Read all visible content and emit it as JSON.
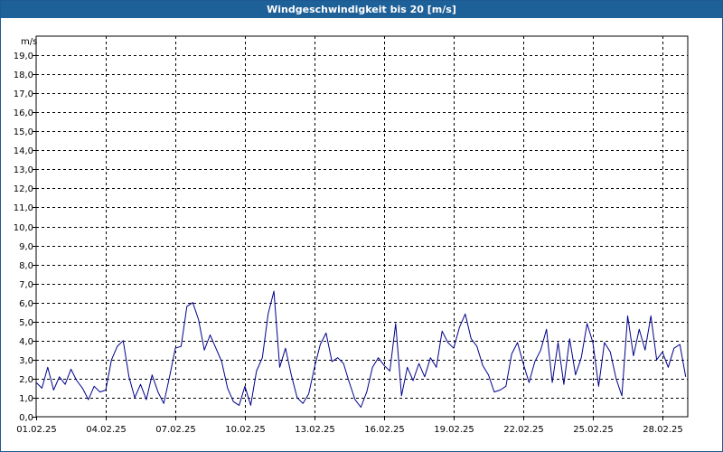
{
  "window": {
    "title": "Windgeschwindigkeit bis 20 [m/s]"
  },
  "chart_data": {
    "type": "line",
    "title": "Windgeschwindigkeit bis 20 [m/s]",
    "ylabel": "m/s",
    "xlabel": "",
    "ylim": [
      0,
      20
    ],
    "y_ticks": [
      0.0,
      1.0,
      2.0,
      3.0,
      4.0,
      5.0,
      6.0,
      7.0,
      8.0,
      9.0,
      10.0,
      11.0,
      12.0,
      13.0,
      14.0,
      15.0,
      16.0,
      17.0,
      18.0,
      19.0
    ],
    "y_tick_labels": [
      "0,0",
      "1,0",
      "2,0",
      "3,0",
      "4,0",
      "5,0",
      "6,0",
      "7,0",
      "8,0",
      "9,0",
      "10,0",
      "11,0",
      "12,0",
      "13,0",
      "14,0",
      "15,0",
      "16,0",
      "17,0",
      "18,0",
      "19,0"
    ],
    "x_tick_labels": [
      "01.02.25",
      "04.02.25",
      "07.02.25",
      "10.02.25",
      "13.02.25",
      "16.02.25",
      "19.02.25",
      "22.02.25",
      "25.02.25",
      "28.02.25"
    ],
    "grid": true,
    "line_color": "#00008b",
    "series": [
      {
        "x": [
          "01.02.25 00h",
          "01.02.25 06h",
          "01.02.25 12h",
          "01.02.25 18h",
          "02.02.25 00h",
          "02.02.25 06h",
          "02.02.25 12h",
          "02.02.25 18h",
          "03.02.25 00h",
          "03.02.25 06h",
          "03.02.25 12h",
          "03.02.25 18h",
          "04.02.25 00h",
          "04.02.25 06h",
          "04.02.25 12h",
          "04.02.25 18h",
          "05.02.25 00h",
          "05.02.25 06h",
          "05.02.25 12h",
          "05.02.25 18h",
          "06.02.25 00h",
          "06.02.25 06h",
          "06.02.25 12h",
          "06.02.25 18h",
          "07.02.25 00h",
          "07.02.25 06h",
          "07.02.25 12h",
          "07.02.25 18h",
          "08.02.25 00h",
          "08.02.25 06h",
          "08.02.25 12h",
          "08.02.25 18h",
          "09.02.25 00h",
          "09.02.25 06h",
          "09.02.25 12h",
          "09.02.25 18h",
          "10.02.25 00h",
          "10.02.25 06h",
          "10.02.25 12h",
          "10.02.25 18h",
          "11.02.25 00h",
          "11.02.25 06h",
          "11.02.25 12h",
          "11.02.25 18h",
          "12.02.25 00h",
          "12.02.25 06h",
          "12.02.25 12h",
          "12.02.25 18h",
          "13.02.25 00h",
          "13.02.25 06h",
          "13.02.25 12h",
          "13.02.25 18h",
          "14.02.25 00h",
          "14.02.25 06h",
          "14.02.25 12h",
          "14.02.25 18h",
          "15.02.25 00h",
          "15.02.25 06h",
          "15.02.25 12h",
          "15.02.25 18h",
          "16.02.25 00h",
          "16.02.25 06h",
          "16.02.25 12h",
          "16.02.25 18h",
          "17.02.25 00h",
          "17.02.25 06h",
          "17.02.25 12h",
          "17.02.25 18h",
          "18.02.25 00h",
          "18.02.25 06h",
          "18.02.25 12h",
          "18.02.25 18h",
          "19.02.25 00h",
          "19.02.25 06h",
          "19.02.25 12h",
          "19.02.25 18h",
          "20.02.25 00h",
          "20.02.25 06h",
          "20.02.25 12h",
          "20.02.25 18h",
          "21.02.25 00h",
          "21.02.25 06h",
          "21.02.25 12h",
          "21.02.25 18h",
          "22.02.25 00h",
          "22.02.25 06h",
          "22.02.25 12h",
          "22.02.25 18h",
          "23.02.25 00h",
          "23.02.25 06h",
          "23.02.25 12h",
          "23.02.25 18h",
          "24.02.25 00h",
          "24.02.25 06h",
          "24.02.25 12h",
          "24.02.25 18h",
          "25.02.25 00h",
          "25.02.25 06h",
          "25.02.25 12h",
          "25.02.25 18h",
          "26.02.25 00h",
          "26.02.25 06h",
          "26.02.25 12h",
          "26.02.25 18h",
          "27.02.25 00h",
          "27.02.25 06h",
          "27.02.25 12h",
          "27.02.25 18h",
          "28.02.25 00h",
          "28.02.25 06h",
          "28.02.25 12h",
          "28.02.25 18h",
          "01.03.25 00h"
        ],
        "values": [
          1.8,
          1.5,
          2.6,
          1.4,
          2.1,
          1.7,
          2.5,
          1.9,
          1.5,
          0.9,
          1.6,
          1.3,
          1.4,
          3.0,
          3.7,
          4.0,
          2.1,
          1.0,
          1.7,
          0.9,
          2.2,
          1.3,
          0.7,
          2.1,
          3.6,
          3.7,
          5.8,
          6.0,
          5.1,
          3.5,
          4.3,
          3.6,
          2.9,
          1.5,
          0.8,
          0.6,
          1.6,
          0.6,
          2.4,
          3.1,
          5.4,
          6.6,
          2.6,
          3.6,
          2.2,
          1.0,
          0.7,
          1.2,
          2.6,
          3.8,
          4.4,
          2.9,
          3.1,
          2.8,
          1.8,
          0.9,
          0.5,
          1.3,
          2.6,
          3.1,
          2.7,
          2.4,
          4.9,
          1.1,
          2.6,
          1.9,
          2.8,
          2.1,
          3.1,
          2.6,
          4.5,
          3.9,
          3.6,
          4.7,
          5.4,
          4.1,
          3.7,
          2.7,
          2.2,
          1.3,
          1.4,
          1.6,
          3.3,
          3.9,
          2.8,
          1.8,
          2.9,
          3.5,
          4.6,
          1.8,
          3.9,
          1.7,
          4.1,
          2.2,
          3.1,
          4.9,
          3.9,
          1.6,
          3.9,
          3.4,
          2.0,
          1.1,
          5.3,
          3.2,
          4.6,
          3.5,
          5.3,
          3.0,
          3.4,
          2.6,
          3.6,
          3.8,
          2.1
        ]
      }
    ]
  }
}
